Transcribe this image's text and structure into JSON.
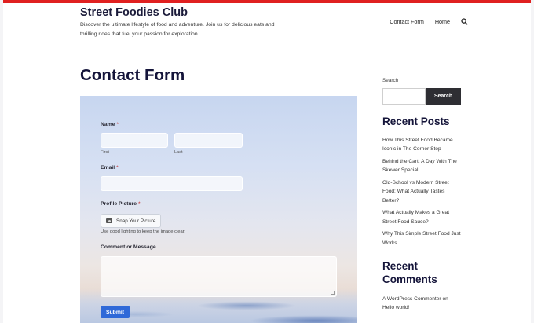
{
  "site": {
    "title": "Street Foodies Club",
    "description": "Discover the ultimate lifestyle of food and adventure. Join us for delicious eats and thrilling rides that fuel your passion for exploration."
  },
  "nav": {
    "items": [
      "Contact Form",
      "Home"
    ],
    "search_icon": "search-icon"
  },
  "page": {
    "title": "Contact Form"
  },
  "form": {
    "name_label": "Name",
    "required_mark": "*",
    "first_sublabel": "First",
    "last_sublabel": "Last",
    "email_label": "Email",
    "profile_label": "Profile Picture",
    "file_button": "Snap Your Picture",
    "file_hint": "Use good lighting to keep the image clear.",
    "comment_label": "Comment or Message",
    "submit_label": "Submit",
    "camera_icon": "camera-icon",
    "submit_color": "#2f69d8"
  },
  "sidebar": {
    "search_label": "Search",
    "search_button": "Search",
    "recent_posts_heading": "Recent Posts",
    "recent_posts": [
      "How This Street Food Became Iconic in The Corner Stop",
      "Behind the Cart: A Day With The Skewer Special",
      "Old-School vs Modern Street Food: What Actually Tastes Better?",
      "What Actually Makes a Great Street Food Sauce?",
      "Why This Simple Street Food Just Works"
    ],
    "recent_comments_heading": "Recent Comments",
    "recent_comments": [
      "A WordPress Commenter on Hello world!"
    ]
  },
  "colors": {
    "accent_bar": "#e02020",
    "title": "#14143a"
  }
}
